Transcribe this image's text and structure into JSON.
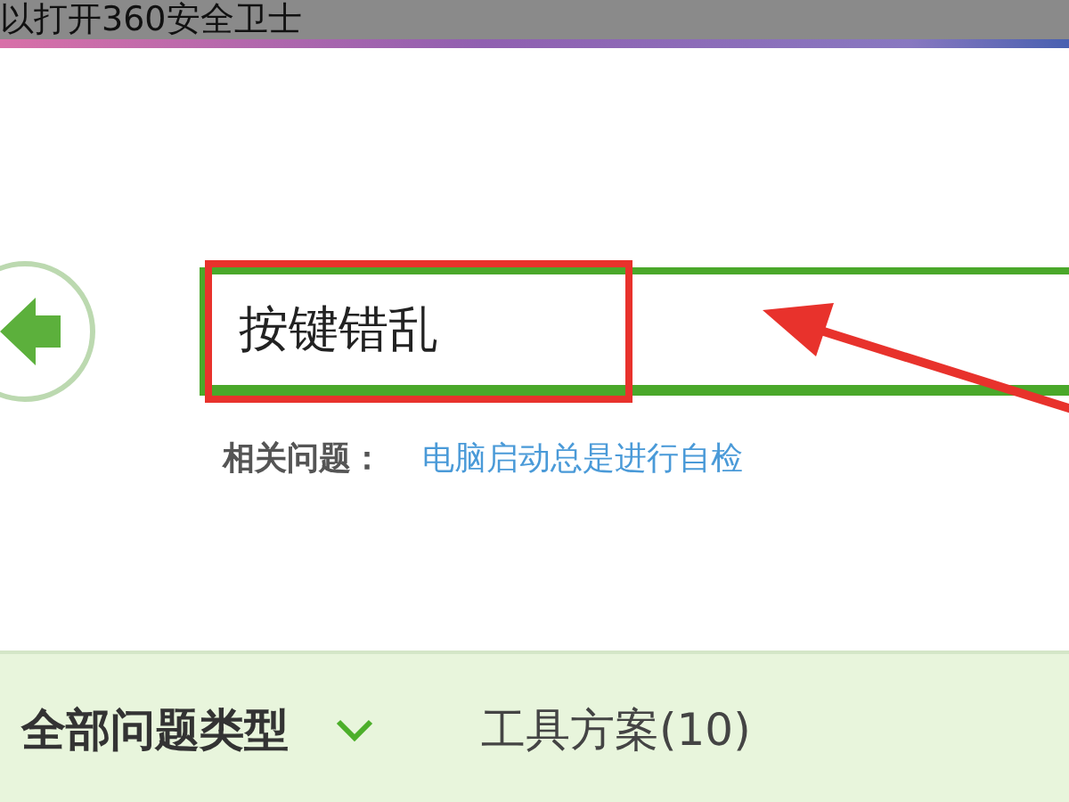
{
  "banner": {
    "text": "以打开360安全卫士"
  },
  "search": {
    "value": "按键错乱"
  },
  "related": {
    "label": "相关问题：",
    "link": "电脑启动总是进行自检"
  },
  "filter_bar": {
    "category": "全部问题类型",
    "tabs": [
      {
        "label": "工具方案(10)",
        "selected": false
      }
    ]
  }
}
